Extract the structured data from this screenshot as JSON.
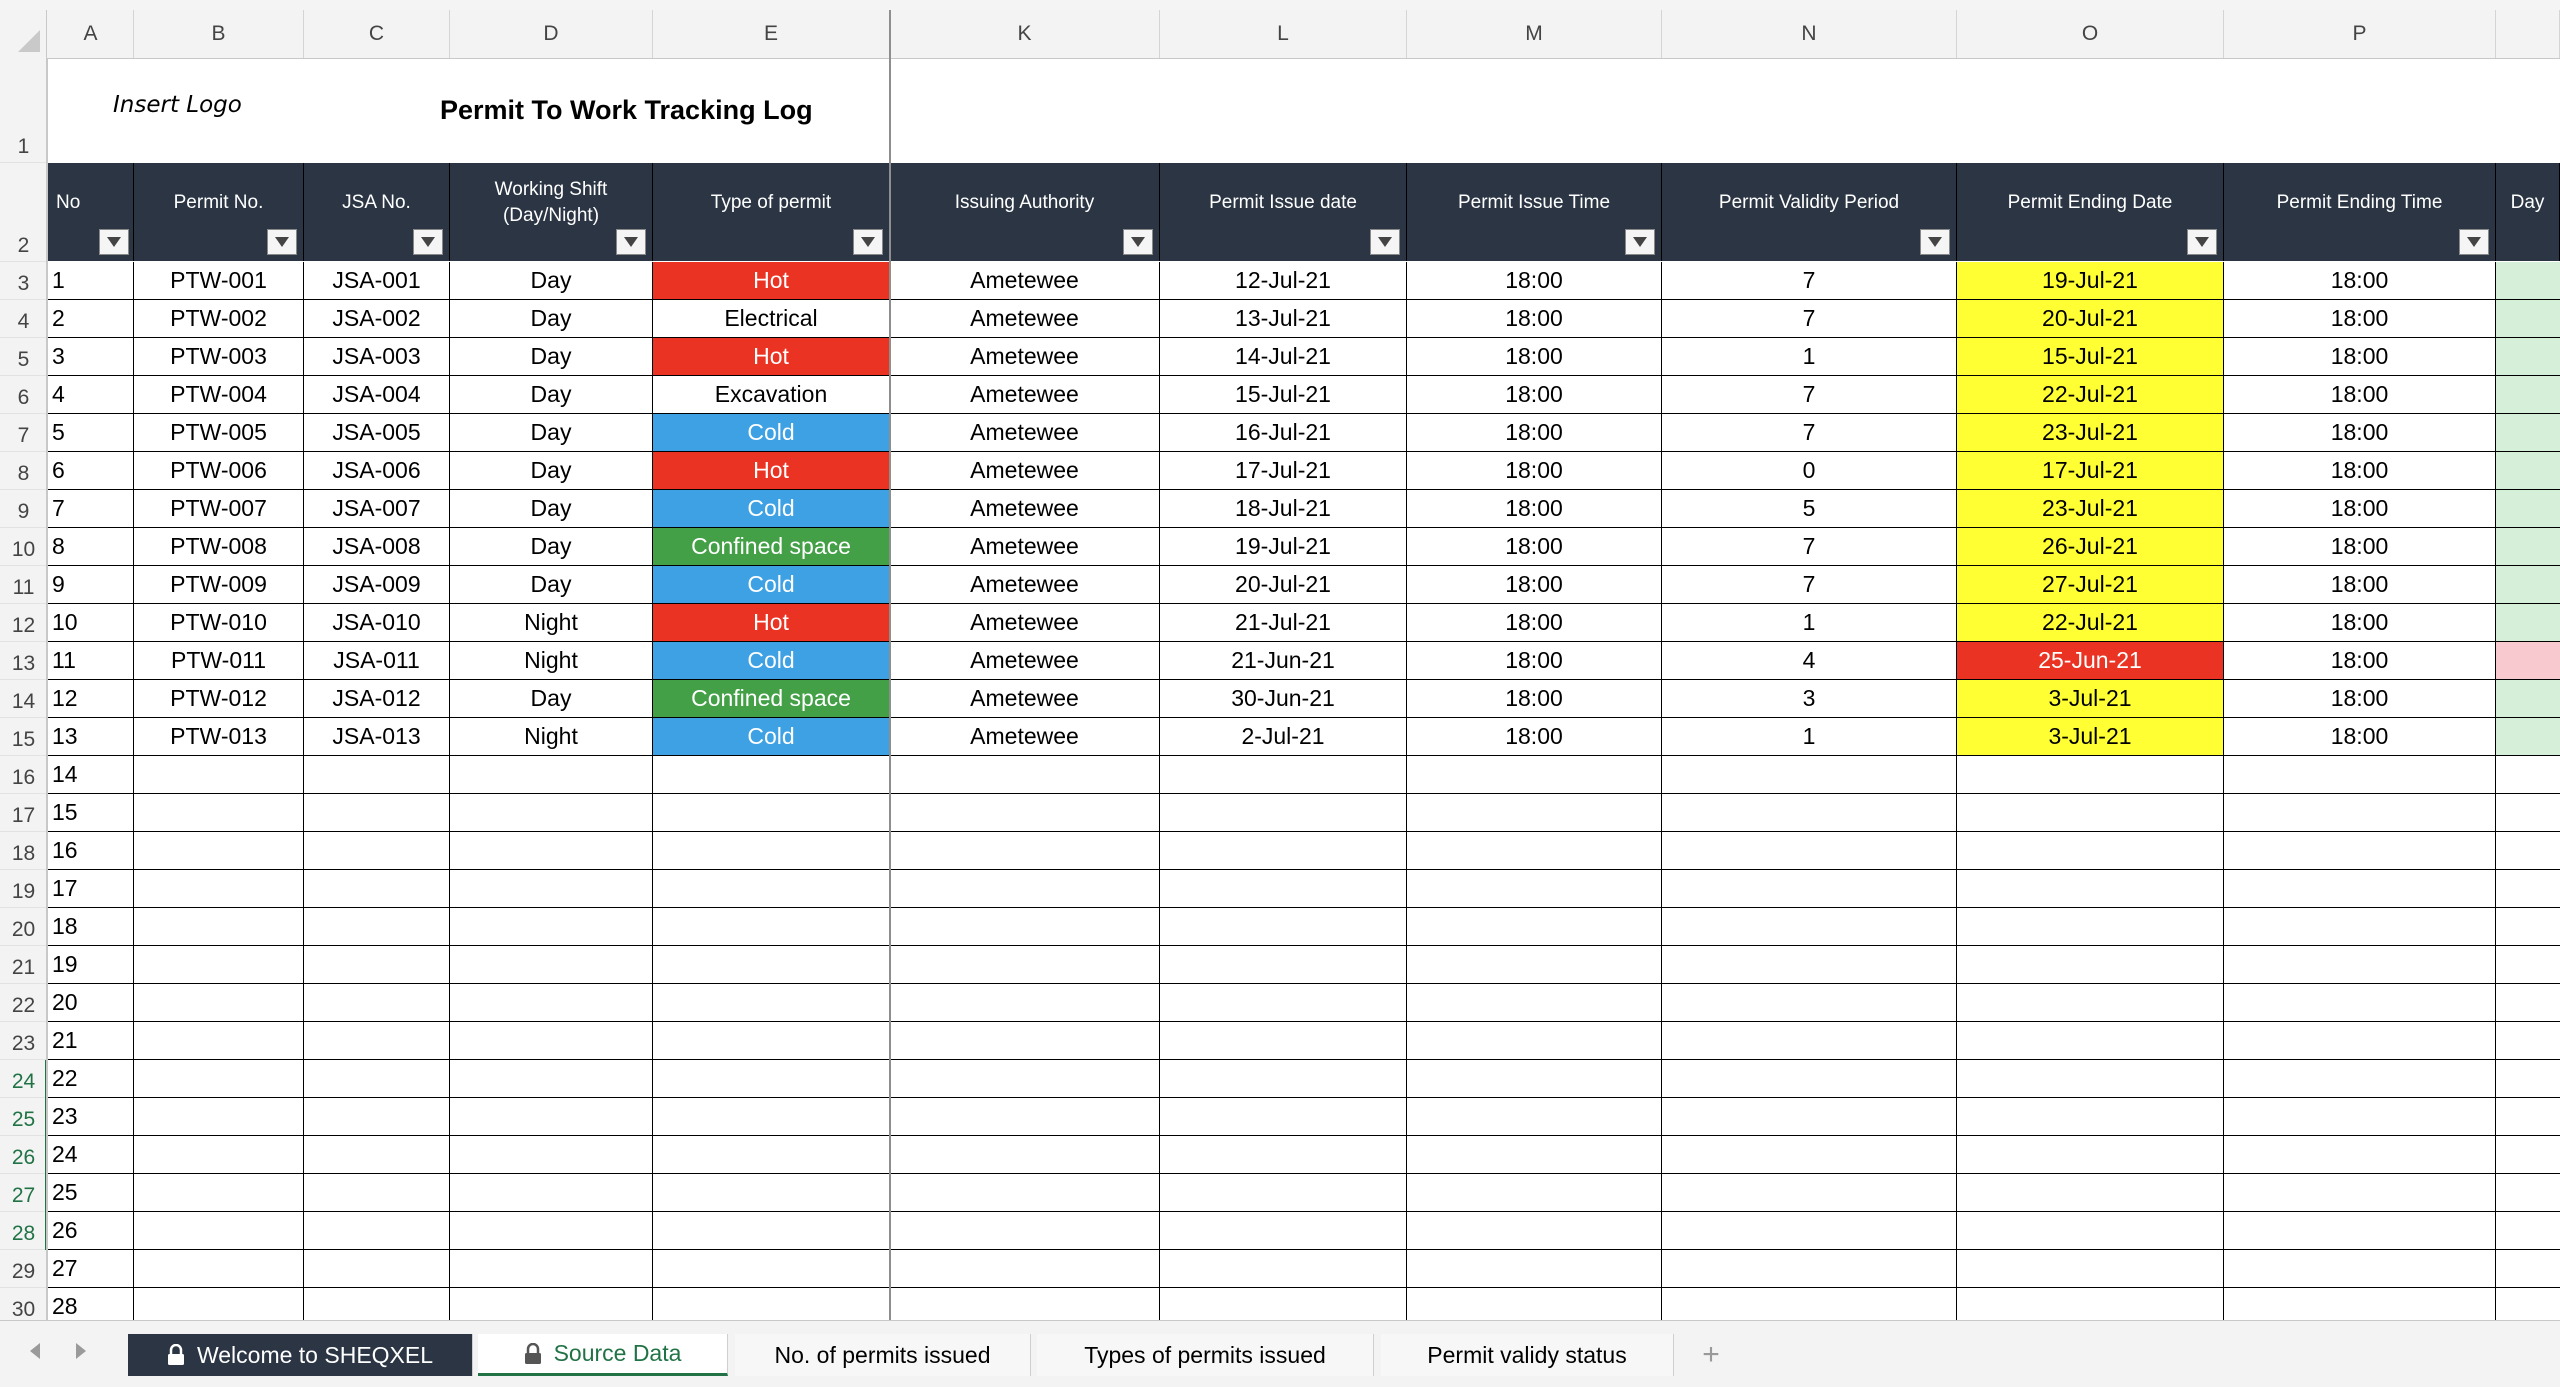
{
  "columns": [
    {
      "letter": "A"
    },
    {
      "letter": "B"
    },
    {
      "letter": "C"
    },
    {
      "letter": "D"
    },
    {
      "letter": "E"
    },
    {
      "letter": "K"
    },
    {
      "letter": "L"
    },
    {
      "letter": "M"
    },
    {
      "letter": "N"
    },
    {
      "letter": "O"
    },
    {
      "letter": "P"
    },
    {
      "letter": ""
    }
  ],
  "row_numbers": [
    "1",
    "2",
    "3",
    "4",
    "5",
    "6",
    "7",
    "8",
    "9",
    "10",
    "11",
    "12",
    "13",
    "14",
    "15",
    "16",
    "17",
    "18",
    "19",
    "20",
    "21",
    "22",
    "23",
    "24",
    "25",
    "26",
    "27",
    "28",
    "29",
    "30"
  ],
  "selected_rows": [
    "24",
    "25",
    "26",
    "27",
    "28"
  ],
  "logo_text": "Insert Logo",
  "title": "Permit To Work Tracking Log",
  "headers": [
    "No",
    "Permit No.",
    "JSA No.",
    "Working Shift\n(Day/Night)",
    "Type of permit",
    "Issuing Authority",
    "Permit Issue date",
    "Permit Issue Time",
    "Permit Validity Period",
    "Permit Ending Date",
    "Permit Ending Time",
    "Day"
  ],
  "data_rows": [
    {
      "no": "1",
      "permit": "PTW-001",
      "jsa": "JSA-001",
      "shift": "Day",
      "type": "Hot",
      "authority": "Ametewee",
      "issue_date": "12-Jul-21",
      "issue_time": "18:00",
      "validity": "7",
      "end_date": "19-Jul-21",
      "end_time": "18:00",
      "status": "green"
    },
    {
      "no": "2",
      "permit": "PTW-002",
      "jsa": "JSA-002",
      "shift": "Day",
      "type": "Electrical",
      "authority": "Ametewee",
      "issue_date": "13-Jul-21",
      "issue_time": "18:00",
      "validity": "7",
      "end_date": "20-Jul-21",
      "end_time": "18:00",
      "status": "green"
    },
    {
      "no": "3",
      "permit": "PTW-003",
      "jsa": "JSA-003",
      "shift": "Day",
      "type": "Hot",
      "authority": "Ametewee",
      "issue_date": "14-Jul-21",
      "issue_time": "18:00",
      "validity": "1",
      "end_date": "15-Jul-21",
      "end_time": "18:00",
      "status": "green"
    },
    {
      "no": "4",
      "permit": "PTW-004",
      "jsa": "JSA-004",
      "shift": "Day",
      "type": "Excavation",
      "authority": "Ametewee",
      "issue_date": "15-Jul-21",
      "issue_time": "18:00",
      "validity": "7",
      "end_date": "22-Jul-21",
      "end_time": "18:00",
      "status": "green"
    },
    {
      "no": "5",
      "permit": "PTW-005",
      "jsa": "JSA-005",
      "shift": "Day",
      "type": "Cold",
      "authority": "Ametewee",
      "issue_date": "16-Jul-21",
      "issue_time": "18:00",
      "validity": "7",
      "end_date": "23-Jul-21",
      "end_time": "18:00",
      "status": "green"
    },
    {
      "no": "6",
      "permit": "PTW-006",
      "jsa": "JSA-006",
      "shift": "Day",
      "type": "Hot",
      "authority": "Ametewee",
      "issue_date": "17-Jul-21",
      "issue_time": "18:00",
      "validity": "0",
      "end_date": "17-Jul-21",
      "end_time": "18:00",
      "status": "green"
    },
    {
      "no": "7",
      "permit": "PTW-007",
      "jsa": "JSA-007",
      "shift": "Day",
      "type": "Cold",
      "authority": "Ametewee",
      "issue_date": "18-Jul-21",
      "issue_time": "18:00",
      "validity": "5",
      "end_date": "23-Jul-21",
      "end_time": "18:00",
      "status": "green"
    },
    {
      "no": "8",
      "permit": "PTW-008",
      "jsa": "JSA-008",
      "shift": "Day",
      "type": "Confined space",
      "authority": "Ametewee",
      "issue_date": "19-Jul-21",
      "issue_time": "18:00",
      "validity": "7",
      "end_date": "26-Jul-21",
      "end_time": "18:00",
      "status": "green"
    },
    {
      "no": "9",
      "permit": "PTW-009",
      "jsa": "JSA-009",
      "shift": "Day",
      "type": "Cold",
      "authority": "Ametewee",
      "issue_date": "20-Jul-21",
      "issue_time": "18:00",
      "validity": "7",
      "end_date": "27-Jul-21",
      "end_time": "18:00",
      "status": "green"
    },
    {
      "no": "10",
      "permit": "PTW-010",
      "jsa": "JSA-010",
      "shift": "Night",
      "type": "Hot",
      "authority": "Ametewee",
      "issue_date": "21-Jul-21",
      "issue_time": "18:00",
      "validity": "1",
      "end_date": "22-Jul-21",
      "end_time": "18:00",
      "status": "green"
    },
    {
      "no": "11",
      "permit": "PTW-011",
      "jsa": "JSA-011",
      "shift": "Night",
      "type": "Cold",
      "authority": "Ametewee",
      "issue_date": "21-Jun-21",
      "issue_time": "18:00",
      "validity": "4",
      "end_date": "25-Jun-21",
      "end_time": "18:00",
      "status": "pink"
    },
    {
      "no": "12",
      "permit": "PTW-012",
      "jsa": "JSA-012",
      "shift": "Day",
      "type": "Confined space",
      "authority": "Ametewee",
      "issue_date": "30-Jun-21",
      "issue_time": "18:00",
      "validity": "3",
      "end_date": "3-Jul-21",
      "end_time": "18:00",
      "status": "green"
    },
    {
      "no": "13",
      "permit": "PTW-013",
      "jsa": "JSA-013",
      "shift": "Night",
      "type": "Cold",
      "authority": "Ametewee",
      "issue_date": "2-Jul-21",
      "issue_time": "18:00",
      "validity": "1",
      "end_date": "3-Jul-21",
      "end_time": "18:00",
      "status": "green"
    }
  ],
  "empty_row_numbers": [
    "14",
    "15",
    "16",
    "17",
    "18",
    "19",
    "20",
    "21",
    "22",
    "23",
    "24",
    "25",
    "26",
    "27",
    "28"
  ],
  "colors": {
    "header_bg": "#2b3544",
    "hot": "#ea3323",
    "cold": "#3ea1e4",
    "confined": "#43a047",
    "end_date_ok": "#ffff33",
    "end_date_expired": "#ea3323",
    "status_ok": "#d6efd8",
    "status_expired": "#f8c9cf",
    "accent": "#217346"
  },
  "tabs": [
    {
      "label": "Welcome to SHEQXEL",
      "locked": true,
      "style": "dark"
    },
    {
      "label": "Source Data",
      "locked": true,
      "style": "active"
    },
    {
      "label": "No. of permits issued",
      "locked": false,
      "style": "normal"
    },
    {
      "label": "Types of permits issued",
      "locked": false,
      "style": "normal"
    },
    {
      "label": "Permit validy status",
      "locked": false,
      "style": "normal"
    }
  ],
  "icons": {
    "prev": "chevron-left-icon",
    "next": "chevron-right-icon",
    "add": "plus-icon",
    "lock": "lock-icon",
    "filter": "filter-dropdown-icon"
  }
}
